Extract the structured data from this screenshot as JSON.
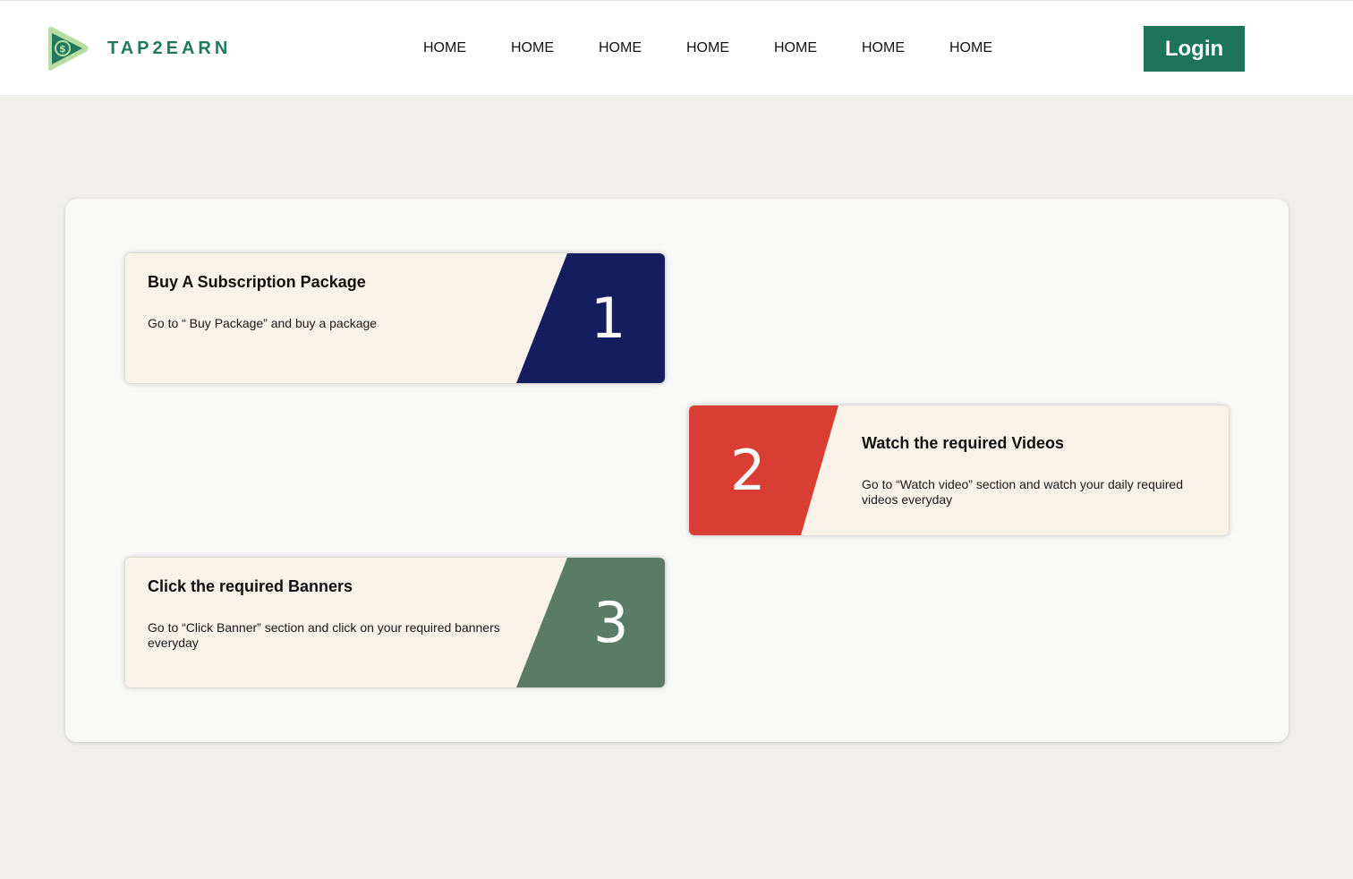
{
  "brand": {
    "name": "TAP2EARN",
    "logo_icon": "play-dollar-icon",
    "color": "#1f7a5e"
  },
  "nav": {
    "items": [
      "HOME",
      "HOME",
      "HOME",
      "HOME",
      "HOME",
      "HOME",
      "HOME"
    ]
  },
  "header": {
    "login_label": "Login",
    "login_color": "#1c7459"
  },
  "steps": [
    {
      "number": "1",
      "title": "Buy A Subscription Package",
      "description": "Go to “ Buy Package” and buy a package",
      "color": "#141d5e"
    },
    {
      "number": "2",
      "title": "Watch the required Videos",
      "description": "Go to “Watch video” section and watch  your daily required videos everyday",
      "color": "#d93e32"
    },
    {
      "number": "3",
      "title": "Click the required Banners",
      "description": "Go to “Click Banner” section and click on your required banners everyday",
      "color": "#5b7b69"
    }
  ]
}
